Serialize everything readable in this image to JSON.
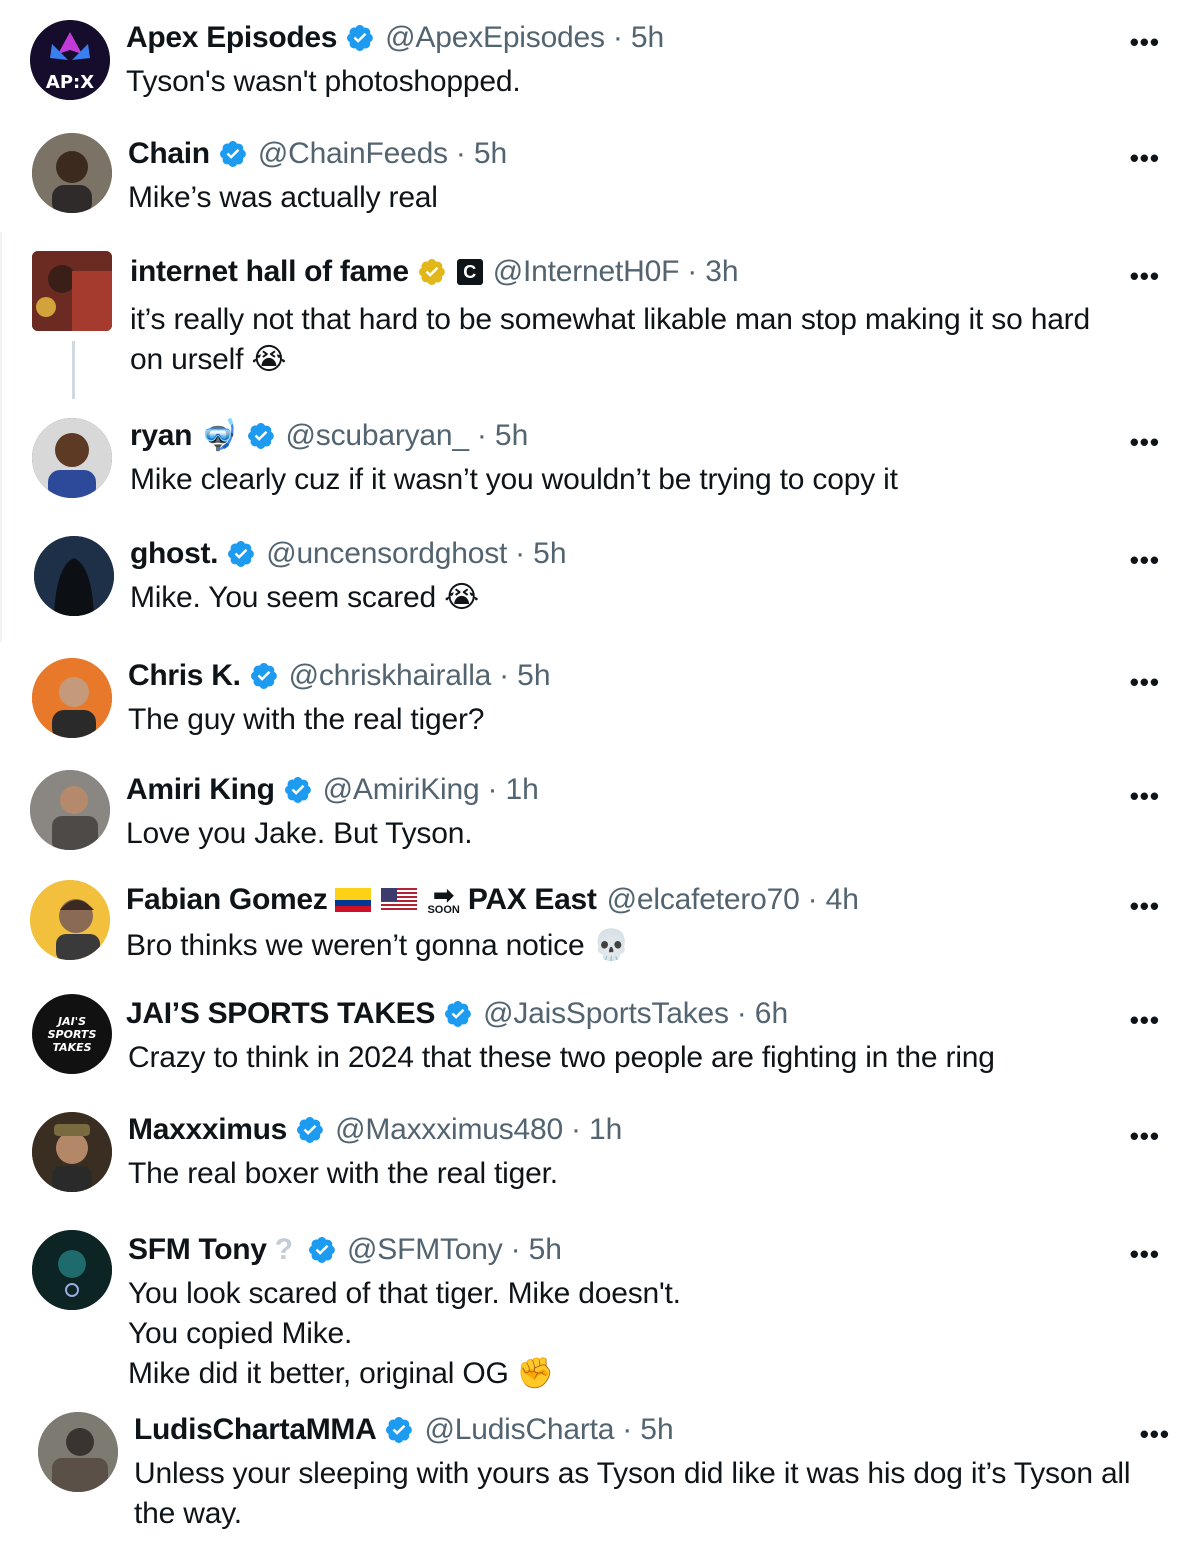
{
  "replies": [
    {
      "name": "Apex Episodes",
      "handle": "@ApexEpisodes",
      "time": "5h",
      "text": "Tyson's wasn't photoshopped.",
      "avatar_text": "AP:X",
      "avatar_color": "#1a1030"
    },
    {
      "name": "Chain",
      "handle": "@ChainFeeds",
      "time": "5h",
      "text": "Mike’s was actually real",
      "avatar_color": "#5a5248"
    },
    {
      "name": "internet hall of fame",
      "handle": "@InternetH0F",
      "time": "3h",
      "text_line1": "it’s really not that hard to be somewhat likable man stop making it so hard",
      "text_line2": "on urself",
      "badge_letter": "C",
      "avatar_color": "#8a2a24"
    },
    {
      "name": "ryan",
      "handle": "@scubaryan_",
      "time": "5h",
      "text": "Mike clearly cuz if it wasn’t you wouldn’t be trying to copy it",
      "avatar_color": "#6b4a36"
    },
    {
      "name": "ghost.",
      "handle": "@uncensordghost",
      "time": "5h",
      "text": "Mike. You seem scared",
      "avatar_color": "#1c2a3c"
    },
    {
      "name": "Chris K.",
      "handle": "@chriskhairalla",
      "time": "5h",
      "text": "The guy with the real tiger?",
      "avatar_color": "#e8792a"
    },
    {
      "name": "Amiri King",
      "handle": "@AmiriKing",
      "time": "1h",
      "text": "Love you Jake. But Tyson.",
      "avatar_color": "#7d7a78"
    },
    {
      "name": "Fabian Gomez",
      "handle": "@elcafetero70",
      "time": "4h",
      "text": "Bro thinks we weren’t gonna notice",
      "extra_label": "PAX East",
      "soon_label": "SOON",
      "avatar_color": "#f2c03c"
    },
    {
      "name": "JAI’S SPORTS TAKES",
      "handle": "@JaisSportsTakes",
      "time": "6h",
      "text": "Crazy to think in 2024 that these two people are fighting in the ring",
      "avatar_text": "JAI'S SPORTS TAKES",
      "avatar_color": "#111111"
    },
    {
      "name": "Maxxximus",
      "handle": "@Maxxximus480",
      "time": "1h",
      "text": "The real boxer with the real tiger.",
      "avatar_color": "#5b4a36"
    },
    {
      "name": "SFM Tony",
      "handle": "@SFMTony",
      "time": "5h",
      "text_line1": "You look scared of that tiger. Mike doesn't.",
      "text_line2": "You copied Mike.",
      "text_line3": "Mike did it better, original OG",
      "avatar_color": "#0f2a2a"
    },
    {
      "name": "LudisChartaMMA",
      "handle": "@LudisCharta",
      "time": "5h",
      "text_line1": "Unless your sleeping with yours as Tyson did like it was his dog it’s Tyson all",
      "text_line2": "the way.",
      "avatar_color": "#6d6a62"
    }
  ],
  "separator": "·",
  "more_label": "•••",
  "colors": {
    "verified": "#1d9bf0",
    "gold": "#e2b719",
    "secondary_text": "#536471"
  }
}
